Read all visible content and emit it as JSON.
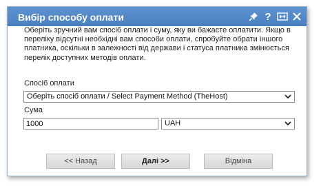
{
  "dialog": {
    "title": "Вибір способу оплати",
    "description": "Оберіть зручний вам спосіб оплати і суму, яку ви бажаєте оплатити. Якщо в переліку відсутні необхідні вам способи оплати, спробуйте обрати іншого платника, оскільки в залежності від держави і статуса платника змінюється перелік доступних методів оплати.",
    "payment_method": {
      "label": "Спосіб оплати",
      "selected": "Оберіть спосіб оплати / Select Payment Method (TheHost)"
    },
    "amount": {
      "label": "Сума",
      "value": "1000"
    },
    "currency": {
      "selected": "UAH"
    },
    "buttons": {
      "back": "<< Назад",
      "next": "Далі >>",
      "cancel": "Відміна"
    },
    "icons": {
      "tools": [
        "pin-icon",
        "help-icon",
        "resize-icon",
        "close-icon"
      ]
    }
  },
  "colors": {
    "titlebar": "#4f86c6",
    "button_bg": "#e2e2e2"
  }
}
